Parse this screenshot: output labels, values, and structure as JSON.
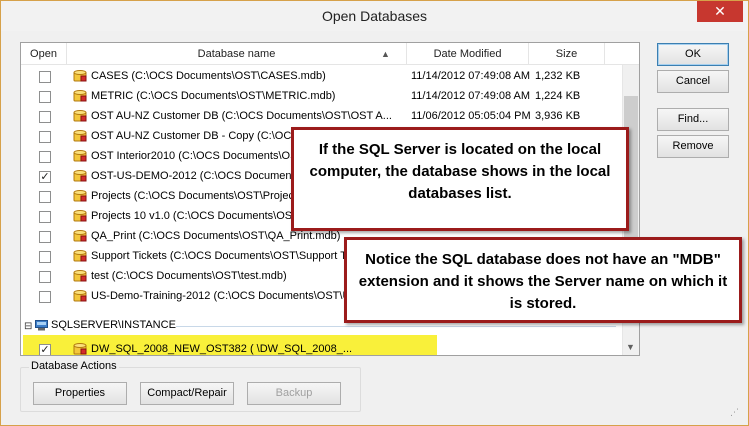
{
  "window": {
    "title": "Open Databases",
    "close_glyph": "✕"
  },
  "columns": {
    "open": "Open",
    "name": "Database name",
    "date": "Date Modified",
    "size": "Size",
    "sort_glyph": "▲"
  },
  "rows": [
    {
      "checked": false,
      "name": "CASES (C:\\OCS Documents\\OST\\CASES.mdb)",
      "date": "11/14/2012 07:49:08 AM",
      "size": "1,232 KB"
    },
    {
      "checked": false,
      "name": "METRIC (C:\\OCS Documents\\OST\\METRIC.mdb)",
      "date": "11/14/2012 07:49:08 AM",
      "size": "1,224 KB"
    },
    {
      "checked": false,
      "name": "OST AU-NZ Customer DB (C:\\OCS Documents\\OST\\OST A...",
      "date": "11/06/2012 05:05:04 PM",
      "size": "3,936 KB"
    },
    {
      "checked": false,
      "name": "OST AU-NZ Customer DB - Copy (C:\\OCS",
      "date": "",
      "size": ""
    },
    {
      "checked": false,
      "name": "OST Interior2010 (C:\\OCS Documents\\OST",
      "date": "",
      "size": ""
    },
    {
      "checked": true,
      "name": "OST-US-DEMO-2012 (C:\\OCS Documents",
      "date": "",
      "size": ""
    },
    {
      "checked": false,
      "name": "Projects (C:\\OCS Documents\\OST\\Project",
      "date": "",
      "size": ""
    },
    {
      "checked": false,
      "name": "Projects 10 v1.0 (C:\\OCS Documents\\OST",
      "date": "",
      "size": ""
    },
    {
      "checked": false,
      "name": "QA_Print (C:\\OCS Documents\\OST\\QA_Print.mdb)",
      "date": "",
      "size": ""
    },
    {
      "checked": false,
      "name": "Support Tickets (C:\\OCS Documents\\OST\\Support T",
      "date": "",
      "size": ""
    },
    {
      "checked": false,
      "name": "test (C:\\OCS Documents\\OST\\test.mdb)",
      "date": "",
      "size": ""
    },
    {
      "checked": false,
      "name": "US-Demo-Training-2012 (C:\\OCS Documents\\OST\\U",
      "date": "",
      "size": ""
    }
  ],
  "sql_group": {
    "collapse_glyph": "⊟",
    "title": "SQLSERVER\\INSTANCE",
    "item": {
      "checked": true,
      "name": "DW_SQL_2008_NEW_OST382 (       \\DW_SQL_2008_..."
    }
  },
  "check_glyph": "✓",
  "buttons": {
    "ok": "OK",
    "cancel": "Cancel",
    "find": "Find...",
    "remove": "Remove"
  },
  "actions": {
    "label": "Database Actions",
    "properties": "Properties",
    "compact": "Compact/Repair",
    "backup": "Backup"
  },
  "callouts": {
    "first": "If the SQL Server is located on the local computer, the database shows in the local databases list.",
    "second": "Notice the SQL database does not have an \"MDB\" extension and it shows the Server name on which it is stored."
  },
  "colors": {
    "callout_border": "#9b1b1b",
    "highlight": "#f9f03a",
    "close": "#c7372f"
  },
  "icons": {
    "database": "database-icon",
    "server": "server-icon"
  }
}
